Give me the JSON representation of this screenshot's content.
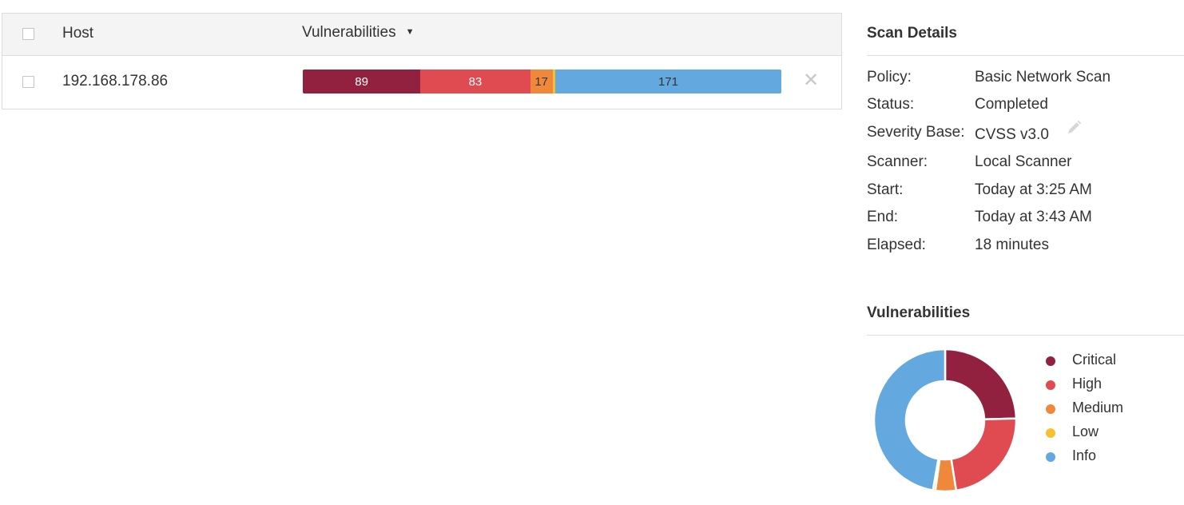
{
  "table": {
    "headers": {
      "host": "Host",
      "vulnerabilities": "Vulnerabilities",
      "sort_indicator": "▼"
    },
    "rows": [
      {
        "host": "192.168.178.86",
        "counts": [
          {
            "label": "89",
            "value": 89,
            "color": "#91213e"
          },
          {
            "label": "83",
            "value": 83,
            "color": "#e04b51"
          },
          {
            "label": "17",
            "value": 17,
            "color": "#f0883c"
          },
          {
            "label": "",
            "value": 2,
            "color": "#f6c131"
          },
          {
            "label": "171",
            "value": 171,
            "color": "#63a9e0"
          }
        ],
        "remove_glyph": "✕"
      }
    ]
  },
  "scan_details": {
    "title": "Scan Details",
    "fields": [
      {
        "label": "Policy:",
        "value": "Basic Network Scan"
      },
      {
        "label": "Status:",
        "value": "Completed"
      },
      {
        "label": "Severity Base:",
        "value": "CVSS v3.0"
      },
      {
        "label": "Scanner:",
        "value": "Local Scanner"
      },
      {
        "label": "Start:",
        "value": "Today at 3:25 AM"
      },
      {
        "label": "End:",
        "value": "Today at 3:43 AM"
      },
      {
        "label": "Elapsed:",
        "value": "18 minutes"
      }
    ],
    "edit_icon": "pencil-icon"
  },
  "vulnerabilities": {
    "title": "Vulnerabilities",
    "legend": [
      {
        "label": "Critical",
        "color": "#91213e"
      },
      {
        "label": "High",
        "color": "#e04b51"
      },
      {
        "label": "Medium",
        "color": "#f0883c"
      },
      {
        "label": "Low",
        "color": "#f6c131"
      },
      {
        "label": "Info",
        "color": "#63a9e0"
      }
    ]
  },
  "chart_data": {
    "type": "pie",
    "categories": [
      "Critical",
      "High",
      "Medium",
      "Low",
      "Info"
    ],
    "values": [
      89,
      83,
      17,
      2,
      171
    ],
    "colors": [
      "#91213e",
      "#e04b51",
      "#f0883c",
      "#f6c131",
      "#63a9e0"
    ],
    "title": "Vulnerabilities",
    "legend": "right"
  }
}
